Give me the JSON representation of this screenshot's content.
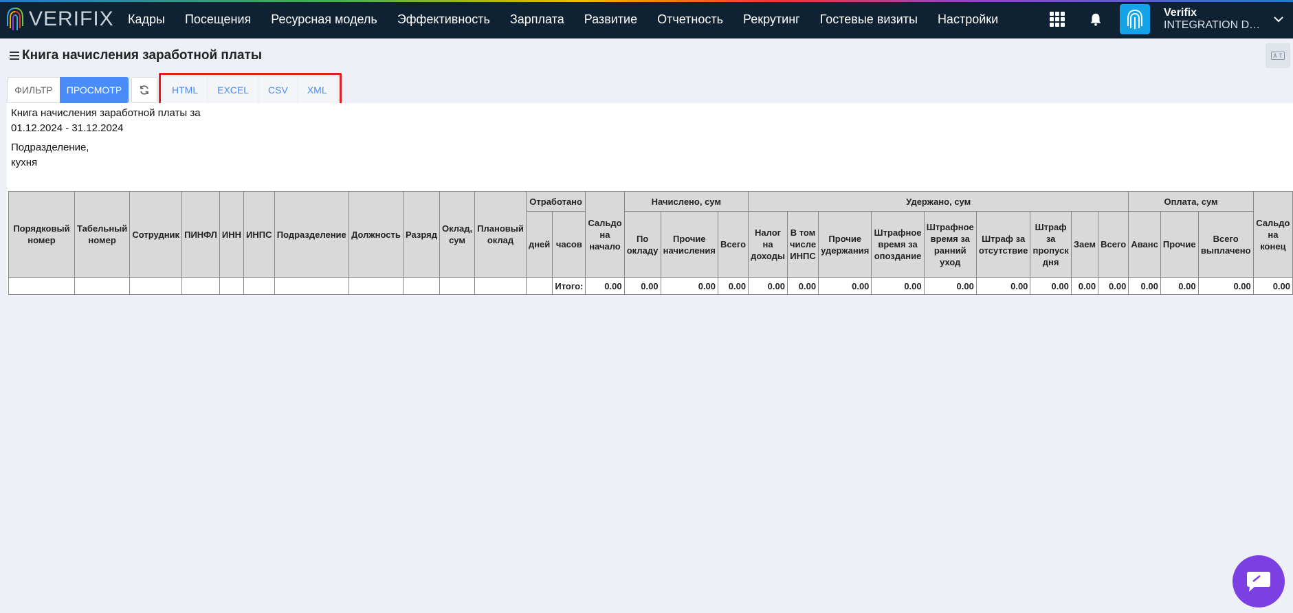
{
  "header": {
    "logo_text": "VERIFIX",
    "nav": [
      "Кадры",
      "Посещения",
      "Ресурсная модель",
      "Эффективность",
      "Зарплата",
      "Развитие",
      "Отчетность",
      "Рекрутинг",
      "Гостевые визиты",
      "Настройки"
    ],
    "user_name": "Verifix",
    "user_org": "INTEGRATION DEPARTMENT"
  },
  "page": {
    "title": "Книга начисления заработной платы"
  },
  "toolbar": {
    "filter_label": "ФИЛЬТР",
    "view_label": "ПРОСМОТР",
    "exports": [
      "HTML",
      "EXCEL",
      "CSV",
      "XML"
    ]
  },
  "report": {
    "title_line1": "Книга начисления заработной платы за",
    "period": "01.12.2024 - 31.12.2024",
    "division_label": "Подразделение,",
    "division_value": "кухня"
  },
  "table": {
    "col_ordinal": "Порядковый номер",
    "col_tab": "Табельный номер",
    "col_employee": "Сотрудник",
    "col_pinfl": "ПИНФЛ",
    "col_inn": "ИНН",
    "col_inps": "ИНПС",
    "col_division": "Подразделение",
    "col_position": "Должность",
    "col_rank": "Разряд",
    "col_salary": "Оклад, сум",
    "col_planned": "Плановый оклад",
    "group_worked": "Отработано",
    "worked_days": "дней",
    "worked_hours": "часов",
    "col_balance_start": "Сальдо на начало",
    "group_accrued": "Начислено, сум",
    "accrued_by_salary": "По окладу",
    "accrued_other": "Прочие начисления",
    "accrued_total": "Всего",
    "group_withheld": "Удержано, сум",
    "wh_income_tax": "Налог на доходы",
    "wh_inps": "В том числе ИНПС",
    "wh_other": "Прочие удержания",
    "wh_late": "Штрафное время за опоздание",
    "wh_early": "Штрафное время за ранний уход",
    "wh_absence": "Штраф за отсутствие",
    "wh_missed_day": "Штраф за пропуск дня",
    "wh_loan": "Заем",
    "wh_total": "Всего",
    "group_paid": "Оплата, сум",
    "paid_advance": "Аванс",
    "paid_other": "Прочие",
    "paid_total": "Всего выплачено",
    "col_balance_end": "Сальдо на конец",
    "total_label": "Итого:",
    "totals": [
      "0.00",
      "0.00",
      "0.00",
      "0.00",
      "0.00",
      "0.00",
      "0.00",
      "0.00",
      "0.00",
      "0.00",
      "0.00",
      "0.00",
      "0.00",
      "0.00",
      "0.00",
      "0.00",
      "0.00"
    ]
  },
  "colors": {
    "header_bg": "#0f2233",
    "primary": "#4a8cf7",
    "highlight": "#e11d1d",
    "chat": "#7b3fe4"
  }
}
